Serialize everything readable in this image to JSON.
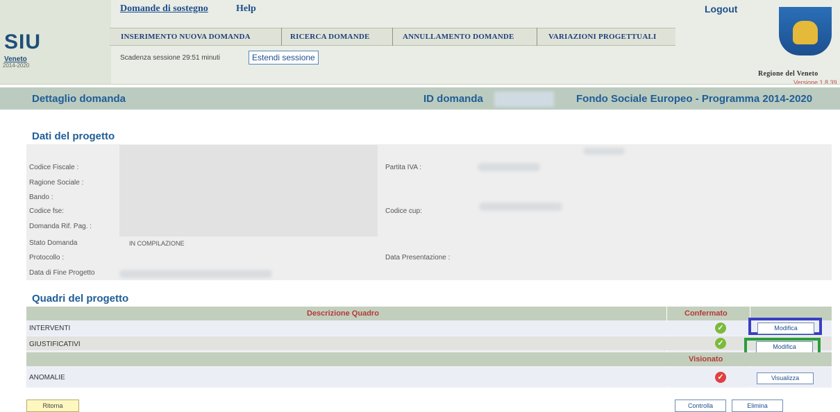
{
  "header": {
    "logo": {
      "siu": "SIU",
      "veneto": "Veneto",
      "years": "2014-2020"
    },
    "links": {
      "domande": "Domande di sostegno",
      "help": "Help",
      "logout": "Logout"
    },
    "menu": [
      "INSERIMENTO NUOVA DOMANDA",
      "RICERCA DOMANDE",
      "ANNULLAMENTO DOMANDE",
      "VARIAZIONI PROGETTUALI"
    ],
    "session_text": "Scadenza sessione 29:51 minuti",
    "extend_session": "Estendi sessione",
    "region": "Regione del Veneto",
    "version": "Versione 1.8.39"
  },
  "titlebar": {
    "detail": "Dettaglio domanda",
    "id_label": "ID domanda",
    "fund": "Fondo Sociale Europeo - Programma 2014-2020"
  },
  "dati": {
    "heading": "Dati del progetto",
    "fields": {
      "codice_fiscale": "Codice Fiscale :",
      "ragione_sociale": "Ragione Sociale :",
      "bando": "Bando :",
      "codice_fse": "Codice fse:",
      "domanda_rif": "Domanda Rif. Pag. :",
      "stato_domanda": "Stato Domanda",
      "stato_value": "IN COMPILAZIONE",
      "protocollo": "Protocollo :",
      "data_fine": "Data di Fine Progetto",
      "partita_iva": "Partita IVA :",
      "codice_cup": "Codice cup:",
      "data_presentazione": "Data Presentazione :"
    }
  },
  "quadri": {
    "heading": "Quadri del progetto",
    "col_descrizione": "Descrizione Quadro",
    "col_confermato": "Confermato",
    "col_visionato": "Visionato",
    "rows": [
      {
        "name": "INTERVENTI",
        "action": "Modifica"
      },
      {
        "name": "GIUSTIFICATIVI",
        "action": "Modifica"
      },
      {
        "name": "ANOMALIE",
        "action": "Visualizza"
      }
    ]
  },
  "footer": {
    "ritorna": "Ritorna",
    "controlla": "Controlla",
    "elimina": "Elimina"
  },
  "colors": {
    "highlight_blue": "#3a3fc4",
    "highlight_green": "#2a9d3a",
    "check_ok": "#7cba3b",
    "check_err": "#e04040"
  }
}
